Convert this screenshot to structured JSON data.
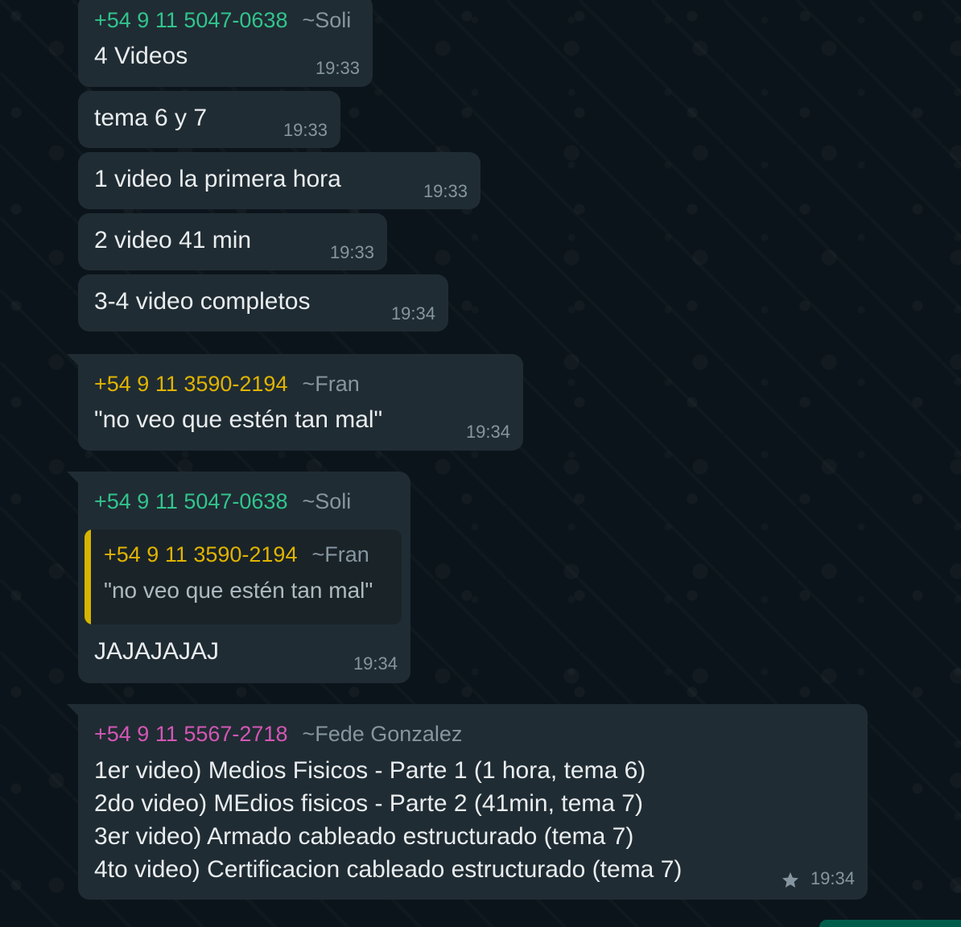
{
  "colors": {
    "soli": "#31c48d",
    "fran": "#e0b400",
    "fede": "#d357b6"
  },
  "messages": [
    {
      "sender_phone": "+54 9 11 5047-0638",
      "sender_alias": "~Soli",
      "text": "4 Videos",
      "time": "19:33"
    },
    {
      "text": "tema 6 y 7",
      "time": "19:33"
    },
    {
      "text": "1 video la primera hora",
      "time": "19:33"
    },
    {
      "text": "2 video 41 min",
      "time": "19:33"
    },
    {
      "text": "3-4 video completos",
      "time": "19:34"
    },
    {
      "sender_phone": "+54 9 11 3590-2194",
      "sender_alias": "~Fran",
      "text": "\"no veo que estén tan mal\"",
      "time": "19:34"
    },
    {
      "sender_phone": "+54 9 11 5047-0638",
      "sender_alias": "~Soli",
      "quoted": {
        "sender_phone": "+54 9 11 3590-2194",
        "sender_alias": "~Fran",
        "text": "\"no veo que estén tan mal\""
      },
      "text": "JAJAJAJAJ",
      "time": "19:34"
    },
    {
      "sender_phone": "+54 9 11 5567-2718",
      "sender_alias": "~Fede Gonzalez",
      "lines": [
        "1er video) Medios Fisicos - Parte 1 (1 hora, tema 6)",
        "2do video) MEdios fisicos - Parte 2 (41min, tema 7)",
        "3er video) Armado cableado estructurado (tema 7)",
        "4to video) Certificacion cableado estructurado (tema 7)"
      ],
      "time": "19:34",
      "starred": true,
      "star_icon": "star-icon"
    }
  ]
}
